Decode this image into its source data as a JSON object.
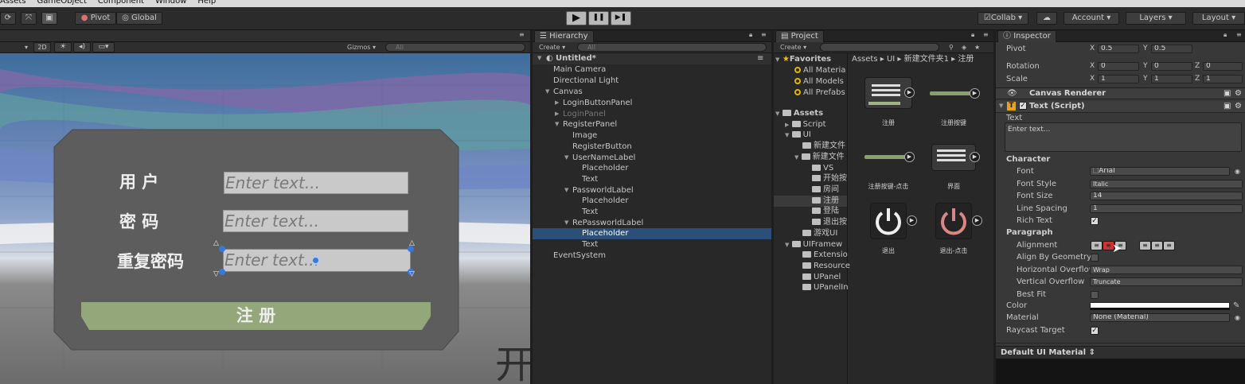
{
  "menu": [
    "Assets",
    "GameObject",
    "Component",
    "Window",
    "Help"
  ],
  "toolbar": {
    "pivot": "Pivot",
    "global": "Global",
    "play": "▶",
    "pause": "❚❚",
    "step": "▶❚",
    "collab": "Collab ▾",
    "account": "Account",
    "layers": "Layers",
    "layout": "Layout"
  },
  "scene": {
    "mode2d": "2D",
    "gizmos": "Gizmos",
    "search_placeholder": "All",
    "label_user": "用 户",
    "label_pass": "密 码",
    "label_repeat": "重复密码",
    "input_placeholder_1": "Enter text...",
    "input_placeholder_2": "Enter text...",
    "input_placeholder_3": "Enter text...",
    "register_button": "注 册",
    "bg_char": "开",
    "colors": {
      "sky": "#6f8fb4",
      "panel": "#5d5d5d",
      "button": "#93a77a"
    }
  },
  "hierarchy": {
    "tab": "Hierarchy",
    "create": "Create",
    "search_placeholder": "All",
    "scene_name": "Untitled*",
    "items": [
      {
        "label": "Main Camera"
      },
      {
        "label": "Directional Light"
      },
      {
        "label": "Canvas"
      },
      {
        "label": "LoginButtonPanel"
      },
      {
        "label": "LoginPanel"
      },
      {
        "label": "RegisterPanel"
      },
      {
        "label": "Image"
      },
      {
        "label": "RegisterButton"
      },
      {
        "label": "UserNameLabel"
      },
      {
        "label": "Placeholder"
      },
      {
        "label": "Text"
      },
      {
        "label": "PassworldLabel"
      },
      {
        "label": "Placeholder"
      },
      {
        "label": "Text"
      },
      {
        "label": "RePassworldLabel"
      },
      {
        "label": "Placeholder"
      },
      {
        "label": "Text"
      },
      {
        "label": "EventSystem"
      }
    ]
  },
  "project": {
    "tab": "Project",
    "create": "Create",
    "favorites": "Favorites",
    "fav_items": [
      "All Materia",
      "All Models",
      "All Prefabs"
    ],
    "assets": "Assets",
    "tree": [
      "Script",
      "UI",
      "新建文件",
      "新建文件",
      "VS",
      "开始按",
      "房间",
      "注册",
      "登陆",
      "退出按",
      "游戏UI",
      "UIFramew",
      "Extensio",
      "Resource",
      "UPanel",
      "UPanelIn"
    ],
    "breadcrumb": [
      "Assets",
      "UI",
      "新建文件夹1",
      "注册"
    ],
    "grid": [
      "注册",
      "注册按键",
      "注册按键-点击",
      "界面",
      "退出",
      "退出-点击"
    ]
  },
  "inspector": {
    "tab": "Inspector",
    "pivot": {
      "label": "Pivot",
      "x": "0.5",
      "y": "0.5"
    },
    "rotation": {
      "label": "Rotation",
      "x": "0",
      "y": "0",
      "z": "0"
    },
    "scale": {
      "label": "Scale",
      "x": "1",
      "y": "1",
      "z": "1"
    },
    "canvas_renderer": "Canvas Renderer",
    "text_script": "Text (Script)",
    "text_label": "Text",
    "text_value": "Enter text...",
    "character": "Character",
    "font": {
      "label": "Font",
      "value": "Arial"
    },
    "font_style": {
      "label": "Font Style",
      "value": "Italic"
    },
    "font_size": {
      "label": "Font Size",
      "value": "14"
    },
    "line_spacing": {
      "label": "Line Spacing",
      "value": "1"
    },
    "rich_text": "Rich Text",
    "paragraph": "Paragraph",
    "alignment": "Alignment",
    "align_by_geometry": "Align By Geometry",
    "h_overflow": {
      "label": "Horizontal Overflow",
      "value": "Wrap"
    },
    "v_overflow": {
      "label": "Vertical Overflow",
      "value": "Truncate"
    },
    "best_fit": "Best Fit",
    "color": "Color",
    "material": {
      "label": "Material",
      "value": "None (Material)"
    },
    "raycast": "Raycast Target",
    "default_material": "Default UI Material"
  }
}
